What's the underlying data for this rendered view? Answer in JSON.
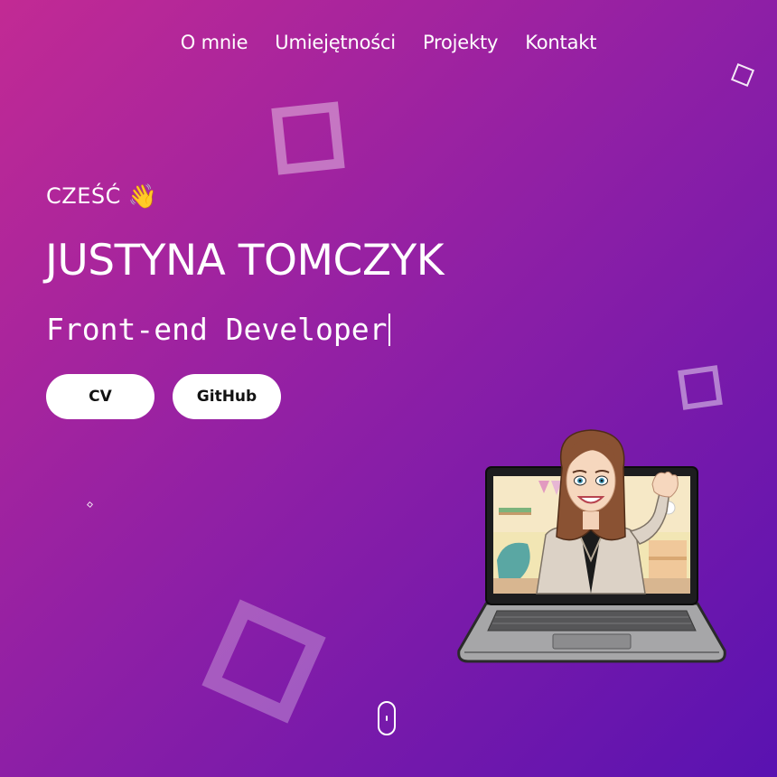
{
  "nav": {
    "items": [
      {
        "label": "O mnie"
      },
      {
        "label": "Umiejętności"
      },
      {
        "label": "Projekty"
      },
      {
        "label": "Kontakt"
      }
    ]
  },
  "hero": {
    "greeting": "CZEŚĆ",
    "greeting_icon": "waving-hand-icon",
    "name": "JUSTYNA TOMCZYK",
    "role": "Front-end Developer",
    "buttons": {
      "cv_label": "CV",
      "github_label": "GitHub"
    },
    "illustration": "avatar-waving-from-laptop",
    "scroll_icon": "mouse-scroll-icon"
  },
  "colors": {
    "gradient_start": "#c22a94",
    "gradient_mid": "#8d1fa6",
    "gradient_end": "#5912b1",
    "text": "#ffffff",
    "button_bg": "#ffffff",
    "button_text": "#121212"
  }
}
